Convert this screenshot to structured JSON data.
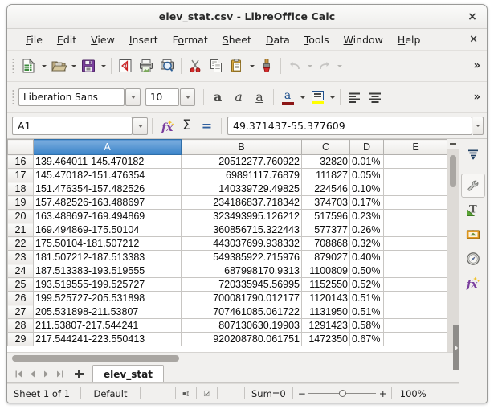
{
  "window": {
    "title": "elev_stat.csv - LibreOffice Calc",
    "close_label": "×"
  },
  "menubar": {
    "items": [
      {
        "name": "file",
        "label": "File",
        "mnemonic": "F"
      },
      {
        "name": "edit",
        "label": "Edit",
        "mnemonic": "E"
      },
      {
        "name": "view",
        "label": "View",
        "mnemonic": "V"
      },
      {
        "name": "insert",
        "label": "Insert",
        "mnemonic": "I"
      },
      {
        "name": "format",
        "label": "Format",
        "mnemonic": "o"
      },
      {
        "name": "sheet",
        "label": "Sheet",
        "mnemonic": "S"
      },
      {
        "name": "data",
        "label": "Data",
        "mnemonic": "D"
      },
      {
        "name": "tools",
        "label": "Tools",
        "mnemonic": "T"
      },
      {
        "name": "window",
        "label": "Window",
        "mnemonic": "W"
      },
      {
        "name": "help",
        "label": "Help",
        "mnemonic": "H"
      }
    ],
    "doc_close_label": "×"
  },
  "standard_toolbar": {
    "overflow_label": "»",
    "items": [
      {
        "name": "new-document-icon",
        "tooltip": "New",
        "has_dropdown": true
      },
      {
        "name": "open-file-icon",
        "tooltip": "Open",
        "has_dropdown": true
      },
      {
        "name": "save-icon",
        "tooltip": "Save",
        "has_dropdown": true
      },
      {
        "name": "export-pdf-icon",
        "tooltip": "Export as PDF",
        "has_dropdown": false
      },
      {
        "name": "print-icon",
        "tooltip": "Print",
        "has_dropdown": false
      },
      {
        "name": "print-preview-icon",
        "tooltip": "Toggle Print Preview",
        "has_dropdown": false
      },
      {
        "name": "cut-icon",
        "tooltip": "Cut",
        "has_dropdown": false
      },
      {
        "name": "copy-icon",
        "tooltip": "Copy",
        "has_dropdown": false
      },
      {
        "name": "paste-icon",
        "tooltip": "Paste",
        "has_dropdown": true
      },
      {
        "name": "clone-formatting-icon",
        "tooltip": "Clone Formatting",
        "has_dropdown": false
      },
      {
        "name": "undo-icon",
        "tooltip": "Undo",
        "has_dropdown": true,
        "disabled": true
      },
      {
        "name": "redo-icon",
        "tooltip": "Redo",
        "has_dropdown": true,
        "disabled": true
      }
    ]
  },
  "formatting_toolbar": {
    "font_name": "Liberation Sans",
    "font_size": "10",
    "overflow_label": "»",
    "bold_label": "a",
    "italic_label": "a",
    "underline_label": "a",
    "font_color_swatch": "#8c1616",
    "highlight_color_swatch": "#ffff00",
    "items": [
      {
        "name": "bold-button"
      },
      {
        "name": "italic-button"
      },
      {
        "name": "underline-button"
      },
      {
        "name": "font-color-button"
      },
      {
        "name": "highlight-color-button"
      },
      {
        "name": "align-left-button"
      },
      {
        "name": "align-center-button"
      }
    ]
  },
  "formula_bar": {
    "name_box_value": "A1",
    "input_line_value": "49.371437-55.377609",
    "function_wizard_label": "fx",
    "sum_label": "Σ",
    "formula_label": "="
  },
  "spreadsheet": {
    "columns": [
      {
        "name": "col-a",
        "label": "A",
        "selected": true,
        "align": "txt"
      },
      {
        "name": "col-b",
        "label": "B",
        "selected": false,
        "align": "num"
      },
      {
        "name": "col-c",
        "label": "C",
        "selected": false,
        "align": "num"
      },
      {
        "name": "col-d",
        "label": "D",
        "selected": false,
        "align": "txt"
      },
      {
        "name": "col-e",
        "label": "E",
        "selected": false,
        "align": "txt"
      }
    ],
    "rows": [
      {
        "header": "16",
        "cells": [
          "139.464011-145.470182",
          "20512277.760922",
          "32820",
          "0.01%",
          ""
        ]
      },
      {
        "header": "17",
        "cells": [
          "145.470182-151.476354",
          "69891117.76879",
          "111827",
          "0.05%",
          ""
        ]
      },
      {
        "header": "18",
        "cells": [
          "151.476354-157.482526",
          "140339729.49825",
          "224546",
          "0.10%",
          ""
        ]
      },
      {
        "header": "19",
        "cells": [
          "157.482526-163.488697",
          "234186837.718342",
          "374703",
          "0.17%",
          ""
        ]
      },
      {
        "header": "20",
        "cells": [
          "163.488697-169.494869",
          "323493995.126212",
          "517596",
          "0.23%",
          ""
        ]
      },
      {
        "header": "21",
        "cells": [
          "169.494869-175.50104",
          "360856715.322443",
          "577377",
          "0.26%",
          ""
        ]
      },
      {
        "header": "22",
        "cells": [
          "175.50104-181.507212",
          "443037699.938332",
          "708868",
          "0.32%",
          ""
        ]
      },
      {
        "header": "23",
        "cells": [
          "181.507212-187.513383",
          "549385922.715976",
          "879027",
          "0.40%",
          ""
        ]
      },
      {
        "header": "24",
        "cells": [
          "187.513383-193.519555",
          "687998170.9313",
          "1100809",
          "0.50%",
          ""
        ]
      },
      {
        "header": "25",
        "cells": [
          "193.519555-199.525727",
          "720335945.56995",
          "1152550",
          "0.52%",
          ""
        ]
      },
      {
        "header": "26",
        "cells": [
          "199.525727-205.531898",
          "700081790.012177",
          "1120143",
          "0.51%",
          ""
        ]
      },
      {
        "header": "27",
        "cells": [
          "205.531898-211.53807",
          "707461085.061722",
          "1131950",
          "0.51%",
          ""
        ]
      },
      {
        "header": "28",
        "cells": [
          "211.53807-217.544241",
          "807130630.19903",
          "1291423",
          "0.58%",
          ""
        ]
      },
      {
        "header": "29",
        "cells": [
          "217.544241-223.550413",
          "920208780.061751",
          "1472350",
          "0.67%",
          ""
        ]
      }
    ]
  },
  "sheet_tabs": {
    "nav_first_label": "first-sheet",
    "nav_prev_label": "previous-sheet",
    "nav_next_label": "next-sheet",
    "nav_last_label": "last-sheet",
    "add_label": "+",
    "tabs": [
      {
        "name": "elev_stat",
        "label": "elev_stat",
        "active": true
      }
    ]
  },
  "status_bar": {
    "sheet_count": "Sheet 1 of 1",
    "page_style": "Default",
    "selection_mode_icon": "selection-mode-icon",
    "modified_icon": "document-modified-icon",
    "sum_text": "Sum=0",
    "zoom_minus": "−",
    "zoom_plus": "+",
    "zoom_level": "100%"
  },
  "sidebar": {
    "items": [
      {
        "name": "sidebar-settings-icon",
        "label": "Sidebar Settings"
      },
      {
        "name": "properties-icon",
        "label": "Properties"
      },
      {
        "name": "styles-icon",
        "label": "Styles"
      },
      {
        "name": "gallery-icon",
        "label": "Gallery"
      },
      {
        "name": "navigator-icon",
        "label": "Navigator"
      },
      {
        "name": "functions-icon",
        "label": "Functions"
      }
    ]
  }
}
